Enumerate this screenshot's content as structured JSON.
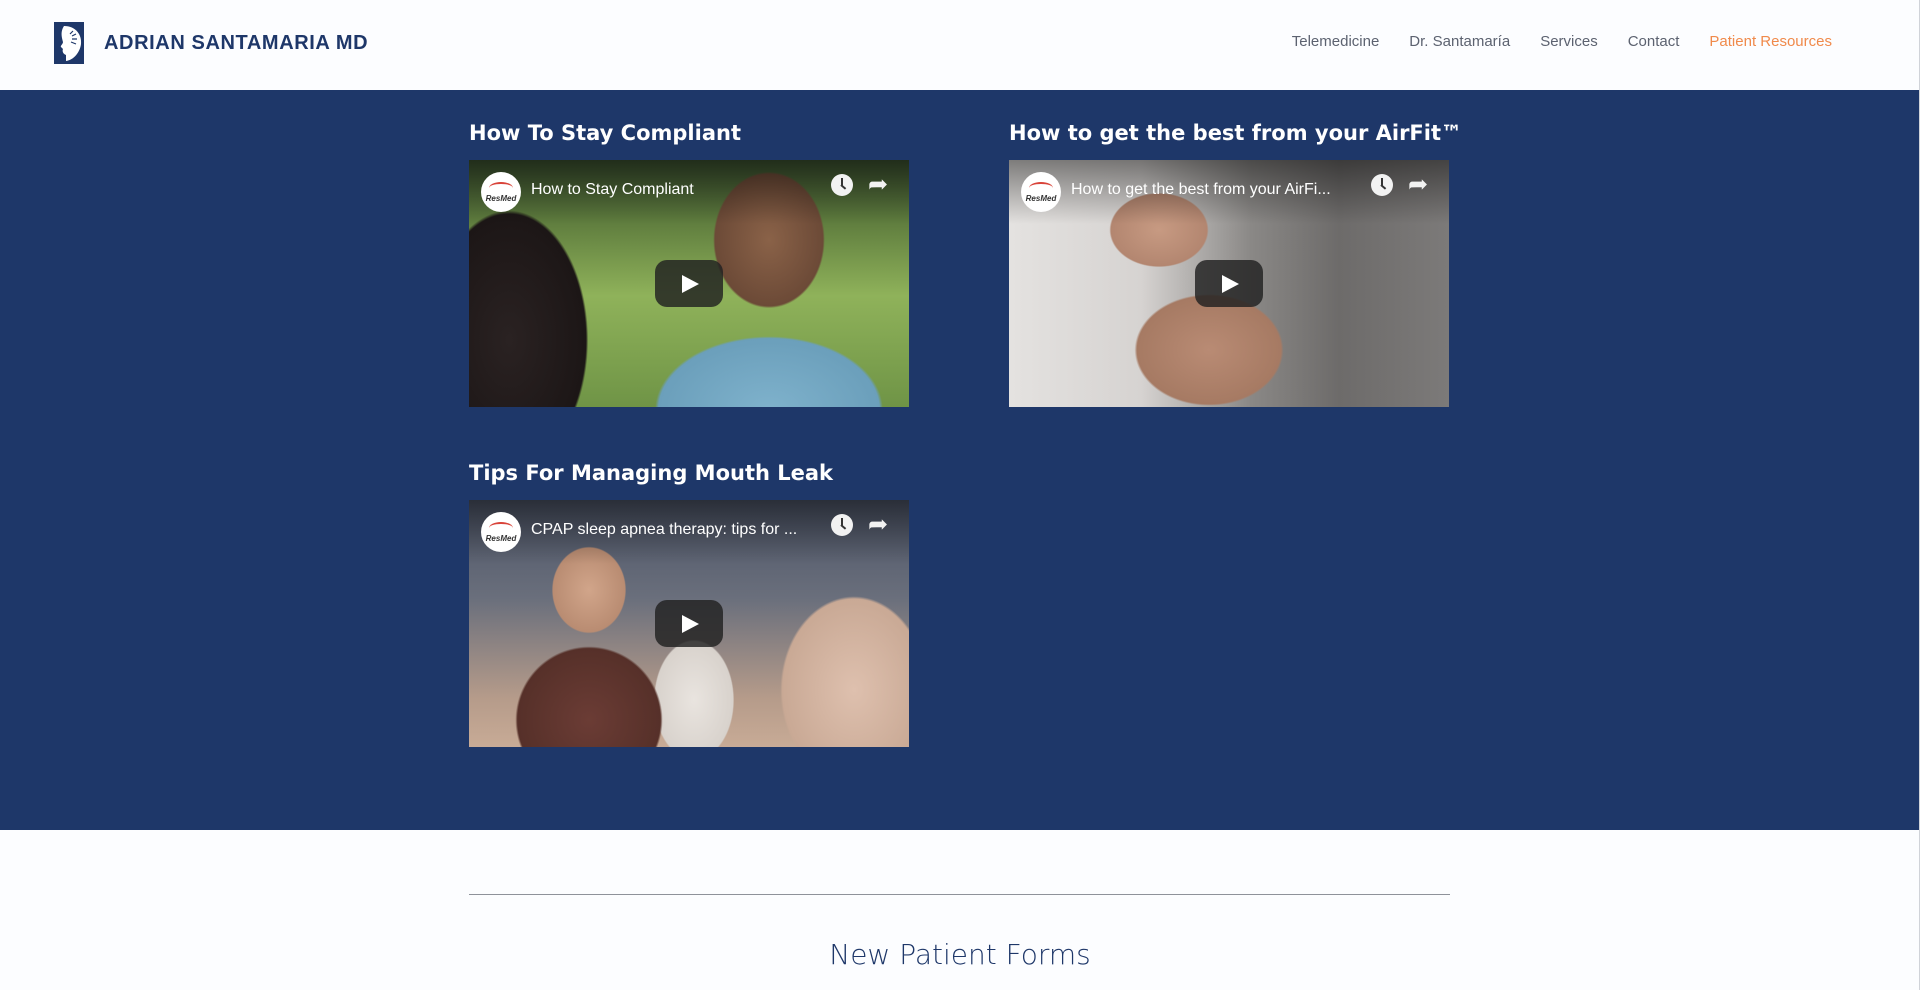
{
  "brand": {
    "name": "ADRIAN SANTAMARIA MD",
    "color": "#1e3769"
  },
  "nav": {
    "items": [
      {
        "label": "Telemedicine",
        "active": false
      },
      {
        "label": "Dr. Santamaría",
        "active": false
      },
      {
        "label": "Services",
        "active": false
      },
      {
        "label": "Contact",
        "active": false
      },
      {
        "label": "Patient Resources",
        "active": true
      }
    ],
    "active_color": "#f08a4b"
  },
  "videos": [
    {
      "heading": "How To Stay Compliant",
      "player_title": "How to Stay Compliant",
      "channel": "ResMed"
    },
    {
      "heading": "How to get the best from your AirFit™",
      "player_title": "How to get the best from your AirFi...",
      "channel": "ResMed"
    },
    {
      "heading": "Tips For Managing Mouth Leak",
      "player_title": "CPAP sleep apnea therapy: tips for ...",
      "channel": "ResMed"
    }
  ],
  "forms": {
    "heading": "New Patient Forms"
  },
  "colors": {
    "section_bg": "#1e3769",
    "page_bg": "#fcfdff"
  }
}
